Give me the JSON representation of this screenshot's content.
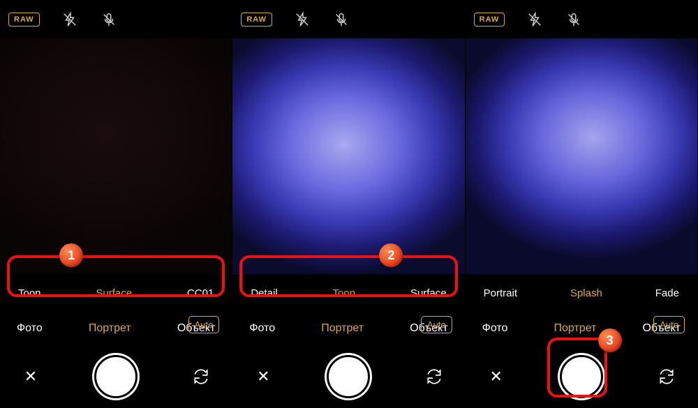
{
  "screens": [
    {
      "raw_label": "RAW",
      "filters": {
        "left": "Toon",
        "center": "Surface",
        "right": "CC01",
        "active": "center"
      },
      "modes": {
        "left": "Фото",
        "center": "Портрет",
        "right": "Объект",
        "active": "center"
      },
      "auto_label": "Auto",
      "callout": "1"
    },
    {
      "raw_label": "RAW",
      "filters": {
        "left": "Detail",
        "center": "Toon",
        "right": "Surface",
        "active": "center"
      },
      "modes": {
        "left": "Фото",
        "center": "Портрет",
        "right": "Объект",
        "active": "center"
      },
      "auto_label": "Auto",
      "callout": "2"
    },
    {
      "raw_label": "RAW",
      "filters": {
        "left": "Portrait",
        "center": "Splash",
        "right": "Fade",
        "active": "center"
      },
      "modes": {
        "left": "Фото",
        "center": "Портрет",
        "right": "Объект",
        "active": "center"
      },
      "auto_label": "Auto",
      "callout": "3"
    }
  ]
}
